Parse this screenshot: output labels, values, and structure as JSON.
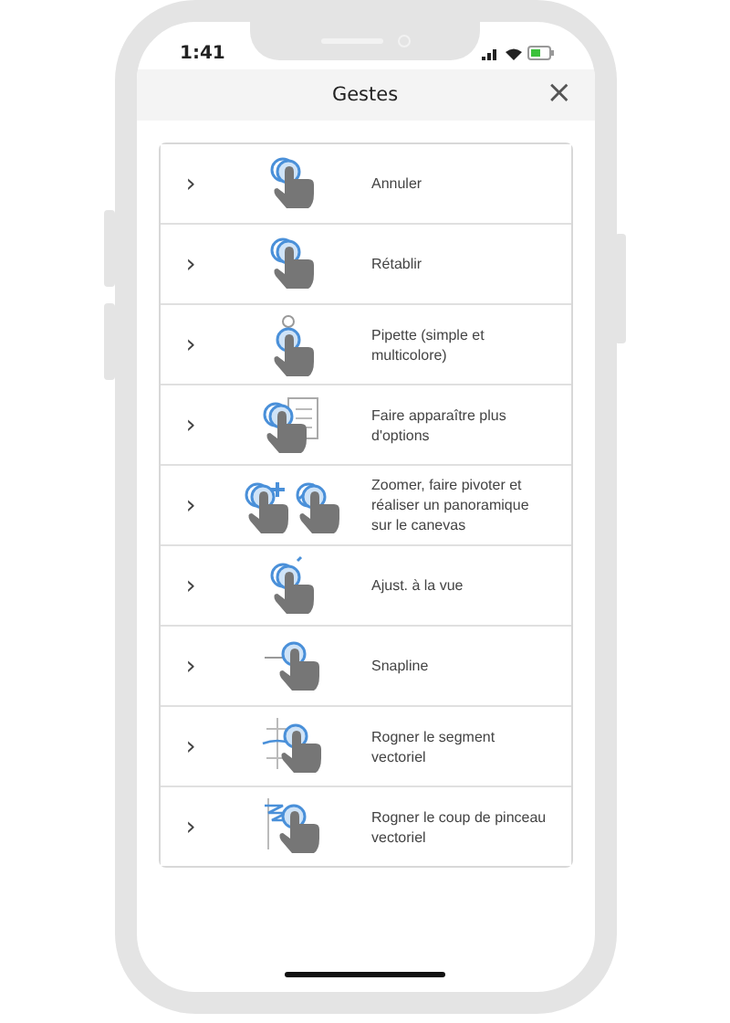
{
  "status_bar": {
    "time": "1:41"
  },
  "header": {
    "title": "Gestes",
    "close": "×"
  },
  "gestures": [
    {
      "label": "Annuler",
      "expand": "›"
    },
    {
      "label": "Rétablir",
      "expand": "›"
    },
    {
      "label": "Pipette (simple et multicolore)",
      "expand": "›"
    },
    {
      "label": "Faire apparaître plus d'options",
      "expand": "›"
    },
    {
      "label": "Zoomer, faire pivoter et réaliser un panoramique sur le canevas",
      "expand": "›"
    },
    {
      "label": "Ajust. à la vue",
      "expand": "›"
    },
    {
      "label": "Snapline",
      "expand": "›"
    },
    {
      "label": "Rogner le segment vectoriel",
      "expand": "›"
    },
    {
      "label": "Rogner le coup de pinceau vectoriel",
      "expand": "›"
    }
  ]
}
